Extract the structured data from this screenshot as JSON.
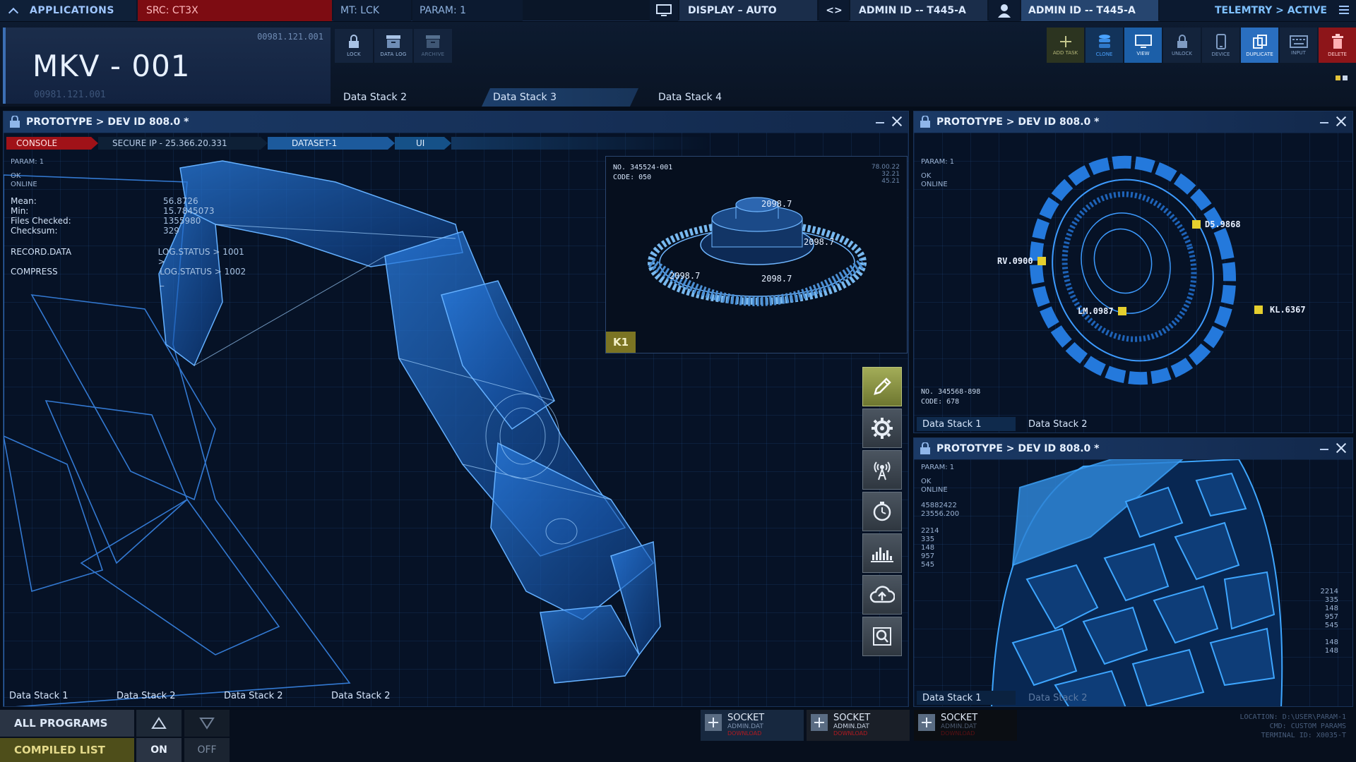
{
  "topbar": {
    "applications": "APPLICATIONS",
    "src": "SRC: CT3X",
    "mt": "MT: LCK",
    "param": "PARAM: 1",
    "display": "DISPLAY – AUTO",
    "admin1": "ADMIN ID -- T445-A",
    "admin2": "ADMIN ID -- T445-A",
    "telemetry": "TELEMTRY > ACTIVE"
  },
  "header": {
    "title": "MKV - 001",
    "code_top": "00981.121.001",
    "code_bottom": "00981.121.001",
    "tools_left": [
      {
        "label": "LOCK",
        "icon": "lock-icon"
      },
      {
        "label": "DATA LOG",
        "icon": "data-log-icon"
      },
      {
        "label": "ARCHIVE",
        "icon": "archive-icon"
      }
    ],
    "tools_right": [
      {
        "label": "ADD TASK",
        "icon": "plus-icon"
      },
      {
        "label": "CLONE",
        "icon": "database-icon"
      },
      {
        "label": "VIEW",
        "icon": "monitor-icon"
      },
      {
        "label": "UNLOCK",
        "icon": "lock-icon"
      },
      {
        "label": "DEVICE",
        "icon": "phone-icon"
      },
      {
        "label": "DUPLICATE",
        "icon": "duplicate-icon"
      },
      {
        "label": "INPUT",
        "icon": "keyboard-icon"
      },
      {
        "label": "DELETE",
        "icon": "trash-icon"
      }
    ],
    "tabs": [
      "Data Stack 2",
      "Data Stack 3",
      "Data Stack 4"
    ],
    "active_tab": "Data Stack 3"
  },
  "main_panel": {
    "title": "PROTOTYPE > DEV ID 808.0 *",
    "console": "CONSOLE",
    "secure_ip": "SECURE IP - 25.366.20.331",
    "dataset": "DATASET-1",
    "ui": "UI",
    "param": "PARAM: 1",
    "status_ok": "OK",
    "status_online": "ONLINE",
    "stats": [
      {
        "k": "Mean:",
        "v": "56.8726"
      },
      {
        "k": "Min:",
        "v": "15.7845073"
      },
      {
        "k": "Files Checked:",
        "v": "1355980"
      },
      {
        "k": "Checksum:",
        "v": "329"
      }
    ],
    "record_label": "RECORD.DATA",
    "compress_label": "COMPRESS",
    "log1": "LOG.STATUS > 1001 >",
    "log2": "LOG.STATUS > 1002 _",
    "inset": {
      "no": "NO. 345524-001",
      "code": "CODE: 050",
      "side": [
        "78.00.22",
        "32.21",
        "45.21"
      ],
      "labels": [
        "2098.7",
        "2098.7",
        "2098.7",
        "2098.7"
      ],
      "tag": "K1"
    },
    "tools": [
      "pencil-icon",
      "gear-icon",
      "antenna-icon",
      "timer-icon",
      "chart-icon",
      "cloud-upload-icon",
      "search-icon"
    ],
    "stacks": [
      "Data Stack 1",
      "Data Stack 2",
      "Data Stack 2",
      "Data Stack 2"
    ]
  },
  "right_panel_1": {
    "title": "PROTOTYPE > DEV ID 808.0 *",
    "param": "PARAM: 1",
    "status_ok": "OK",
    "status_online": "ONLINE",
    "labels": [
      "D5.9868",
      "RV.0900",
      "LM.0987",
      "KL.6367"
    ],
    "no": "NO. 345568-898",
    "code": "CODE: 678",
    "tabs": [
      "Data Stack 1",
      "Data Stack 2"
    ]
  },
  "right_panel_2": {
    "title": "PROTOTYPE > DEV ID 808.0 *",
    "param": "PARAM: 1",
    "status_ok": "OK",
    "status_online": "ONLINE",
    "values_a": [
      "45882422",
      "23556.200"
    ],
    "values_b": [
      "2214",
      "335",
      "148",
      "957",
      "545"
    ],
    "values_right": [
      "2214",
      "335",
      "148",
      "957",
      "545",
      "148",
      "148"
    ],
    "tabs": [
      "Data Stack 1",
      "Data Stack 2"
    ]
  },
  "bottombar": {
    "all_programs": "ALL PROGRAMS",
    "compiled_list": "COMPILED LIST",
    "on": "ON",
    "off": "OFF",
    "sockets": [
      {
        "title": "SOCKET",
        "file": "ADMIN.DAT",
        "status": "DOWNLOAD"
      },
      {
        "title": "SOCKET",
        "file": "ADMIN.DAT",
        "status": "DOWNLOAD"
      },
      {
        "title": "SOCKET",
        "file": "ADMIN.DAT",
        "status": "DOWNLOAD"
      }
    ],
    "location": "LOCATION: D:\\USER\\PARAM-1",
    "cmd": "CMD: CUSTOM PARAMS",
    "terminal": "TERMINAL ID: X0035-T"
  },
  "colors": {
    "accent_blue": "#1c5fa8",
    "alert_red": "#a01218",
    "highlight_yellow": "#e5cf2e",
    "background": "#050d1a"
  }
}
